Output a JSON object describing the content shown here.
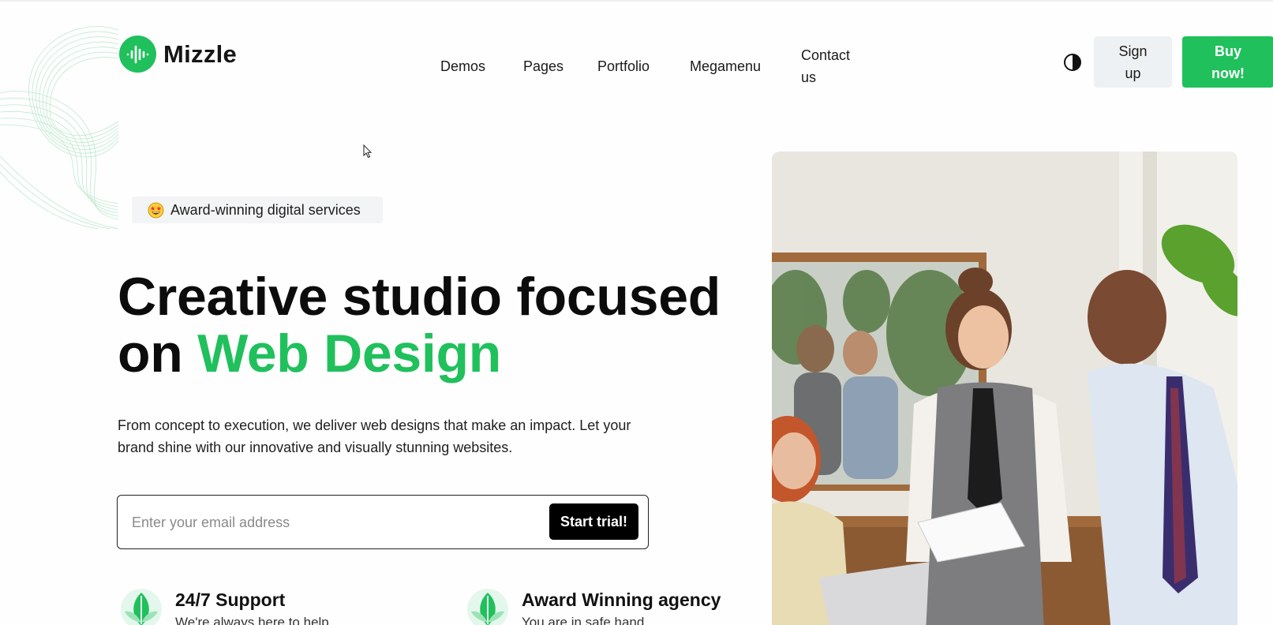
{
  "brand": {
    "name": "Mizzle",
    "accent_color": "#20c05c",
    "logo_icon": "soundwave-icon"
  },
  "nav": {
    "items": [
      {
        "label": "Demos"
      },
      {
        "label": "Pages"
      },
      {
        "label": "Portfolio"
      },
      {
        "label": "Megamenu"
      },
      {
        "label": "Contact us"
      }
    ],
    "theme_toggle_icon": "contrast-icon",
    "signup_label": "Sign up",
    "buy_label": "Buy now!"
  },
  "hero": {
    "badge_emoji": "star-struck-emoji-icon",
    "badge_text": "Award-winning digital services",
    "title_line1": "Creative studio focused",
    "title_on": "on ",
    "title_accent": "Web Design",
    "description": "From concept to execution, we deliver web designs that make an impact. Let your brand shine with our innovative and visually stunning websites.",
    "email_placeholder": "Enter your email address",
    "cta_label": "Start trial!"
  },
  "features": [
    {
      "icon": "leaf-icon",
      "title": "24/7 Support",
      "subtitle": "We're always here to help"
    },
    {
      "icon": "leaf-icon",
      "title": "Award Winning agency",
      "subtitle": "You are in safe hand"
    }
  ],
  "photo": {
    "icon": "office-team-photo"
  }
}
